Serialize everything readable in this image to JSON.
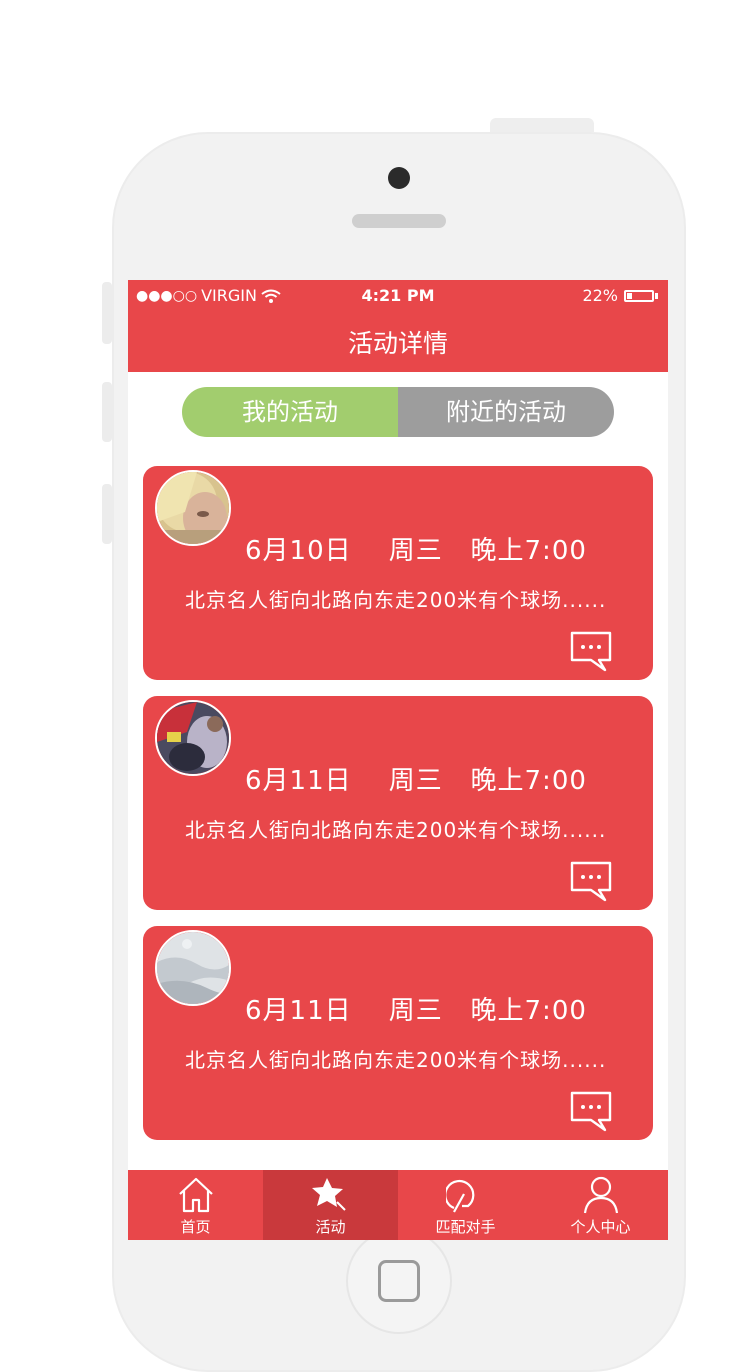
{
  "status_bar": {
    "signal": "●●●○○",
    "carrier": "VIRGIN",
    "time": "4:21 PM",
    "battery": "22%",
    "battery_level": 0.22
  },
  "header": {
    "title": "活动详情"
  },
  "segment": {
    "tabs": [
      {
        "label": "我的活动",
        "active": true
      },
      {
        "label": "附近的活动",
        "active": false
      }
    ]
  },
  "activities": [
    {
      "date": "6月10日",
      "weekday": "周三",
      "time": "晚上7:00",
      "description": "北京名人街向北路向东走200米有个球场......"
    },
    {
      "date": "6月11日",
      "weekday": "周三",
      "time": "晚上7:00",
      "description": "北京名人街向北路向东走200米有个球场......"
    },
    {
      "date": "6月11日",
      "weekday": "周三",
      "time": "晚上7:00",
      "description": "北京名人街向北路向东走200米有个球场......"
    }
  ],
  "tabbar": {
    "items": [
      {
        "label": "首页",
        "icon": "home-icon"
      },
      {
        "label": "活动",
        "icon": "star-icon",
        "active": true
      },
      {
        "label": "匹配对手",
        "icon": "match-icon"
      },
      {
        "label": "个人中心",
        "icon": "user-icon"
      }
    ]
  },
  "colors": {
    "primary": "#e8474a",
    "active_tab": "#c9393c",
    "segment_active": "#a2cd6e",
    "segment_inactive": "#9d9d9d",
    "frame": "#f2f2f2"
  }
}
